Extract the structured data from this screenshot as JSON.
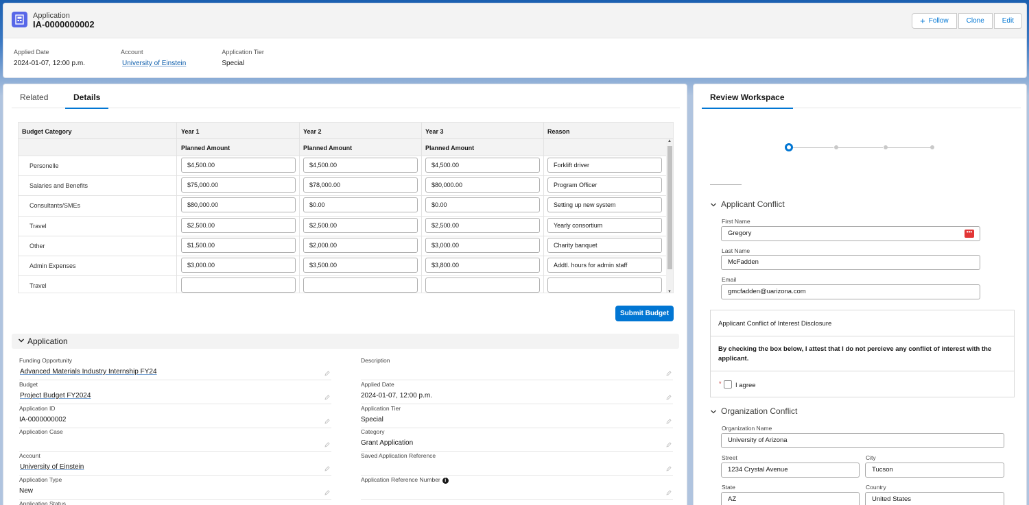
{
  "header": {
    "object_label": "Application",
    "record_title": "IA-0000000002",
    "buttons": {
      "follow": "Follow",
      "clone": "Clone",
      "edit": "Edit"
    },
    "fields": [
      {
        "label": "Applied Date",
        "value": "2024-01-07, 12:00 p.m."
      },
      {
        "label": "Account",
        "value": "University of Einstein"
      },
      {
        "label": "Application Tier",
        "value": "Special"
      }
    ]
  },
  "tabs": {
    "related": "Related",
    "details": "Details"
  },
  "budget": {
    "headers": {
      "category": "Budget Category",
      "year1": "Year 1",
      "year2": "Year 2",
      "year3": "Year 3",
      "reason": "Reason"
    },
    "subheader": "Planned Amount",
    "rows": [
      {
        "category": "Personelle",
        "y1": "$4,500.00",
        "y2": "$4,500.00",
        "y3": "$4,500.00",
        "reason": "Forklift driver"
      },
      {
        "category": "Salaries and Benefits",
        "y1": "$75,000.00",
        "y2": "$78,000.00",
        "y3": "$80,000.00",
        "reason": "Program Officer"
      },
      {
        "category": "Consultants/SMEs",
        "y1": "$80,000.00",
        "y2": "$0.00",
        "y3": "$0.00",
        "reason": "Setting up new system"
      },
      {
        "category": "Travel",
        "y1": "$2,500.00",
        "y2": "$2,500.00",
        "y3": "$2,500.00",
        "reason": "Yearly consortium"
      },
      {
        "category": "Other",
        "y1": "$1,500.00",
        "y2": "$2,000.00",
        "y3": "$3,000.00",
        "reason": "Charity banquet"
      },
      {
        "category": "Admin Expenses",
        "y1": "$3,000.00",
        "y2": "$3,500.00",
        "y3": "$3,800.00",
        "reason": "Addtl. hours for admin staff"
      },
      {
        "category": "Travel",
        "y1": "",
        "y2": "",
        "y3": "",
        "reason": ""
      }
    ],
    "submit": "Submit Budget"
  },
  "application": {
    "section_title": "Application",
    "left": [
      {
        "label": "Funding Opportunity",
        "value": "Advanced Materials Industry Internship FY24",
        "link": true
      },
      {
        "label": "Budget",
        "value": "Project Budget FY2024",
        "link": true
      },
      {
        "label": "Application ID",
        "value": "IA-0000000002",
        "link": false
      },
      {
        "label": "Application Case",
        "value": "",
        "link": false
      },
      {
        "label": "Account",
        "value": "University of Einstein",
        "link": true
      },
      {
        "label": "Application Type",
        "value": "New",
        "link": false
      },
      {
        "label": "Application Status",
        "value": "",
        "link": false
      }
    ],
    "right": [
      {
        "label": "Description",
        "value": ""
      },
      {
        "label": "Applied Date",
        "value": "2024-01-07, 12:00 p.m."
      },
      {
        "label": "Application Tier",
        "value": "Special"
      },
      {
        "label": "Category",
        "value": "Grant Application"
      },
      {
        "label": "Saved Application Reference",
        "value": ""
      },
      {
        "label": "Application Reference Number",
        "value": ""
      }
    ]
  },
  "review": {
    "tab": "Review Workspace",
    "applicant_section": "Applicant Conflict",
    "first_name_label": "First Name",
    "first_name": "Gregory",
    "last_name_label": "Last Name",
    "last_name": "McFadden",
    "email_label": "Email",
    "email": "gmcfadden@uarizona.com",
    "coi_title": "Applicant Conflict of Interest Disclosure",
    "coi_text": "By checking the box below, I attest that I do not percieve any conflict of interest with the applicant.",
    "required_mark": "*",
    "agree": "I agree",
    "org_section": "Organization Conflict",
    "org_name_label": "Organization Name",
    "org_name": "University of Arizona",
    "street_label": "Street",
    "street": "1234 Crystal Avenue",
    "city_label": "City",
    "city": "Tucson",
    "state_label": "State",
    "state": "AZ",
    "country_label": "Country",
    "country": "United States"
  },
  "colors": {
    "brand": "#0176d3",
    "record_icon": "#5867e8",
    "link": "#0b5cab"
  }
}
